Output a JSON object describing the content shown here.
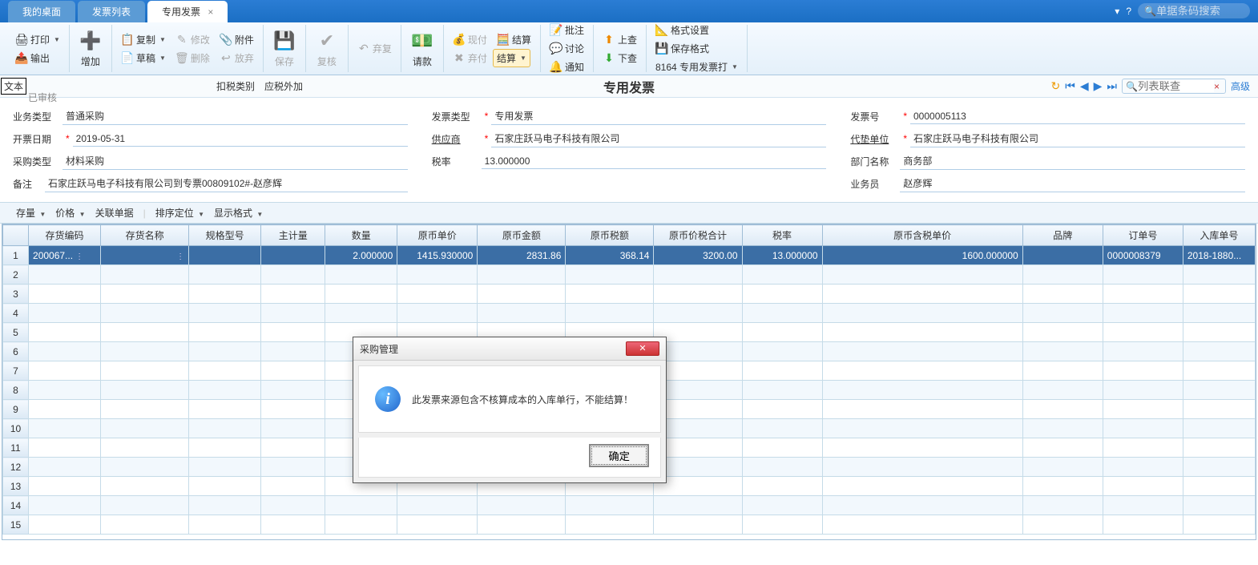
{
  "tabs": {
    "desktop": "我的桌面",
    "list": "发票列表",
    "current": "专用发票"
  },
  "topSearch": {
    "placeholder": "单据条码搜索"
  },
  "ribbon": {
    "print": "打印",
    "output": "输出",
    "add": "增加",
    "copy": "复制",
    "draft": "草稿",
    "modify": "修改",
    "delete": "删除",
    "attach": "附件",
    "abandon": "放弃",
    "save": "保存",
    "recheck": "复核",
    "recover": "弃复",
    "payreq": "请款",
    "cash": "现付",
    "abandonpay": "弃付",
    "settle": "结算",
    "settlebtn": "结算",
    "annotate": "批注",
    "discuss": "讨论",
    "notify": "通知",
    "prev": "上查",
    "next": "下查",
    "format": "格式设置",
    "saveformat": "保存格式",
    "printtpl": "8164 专用发票打"
  },
  "overlayText": "文本",
  "approveStatus": "已审核",
  "titleBar": {
    "taxTypeLabel": "扣税类别",
    "taxTypeVal": "应税外加",
    "title": "专用发票",
    "listSearch": "列表联查",
    "advanced": "高级"
  },
  "form": {
    "bizTypeLabel": "业务类型",
    "bizTypeVal": "普通采购",
    "invTypeLabel": "发票类型",
    "invTypeVal": "专用发票",
    "invNoLabel": "发票号",
    "invNoVal": "0000005113",
    "invDateLabel": "开票日期",
    "invDateVal": "2019-05-31",
    "supplierLabel": "供应商",
    "supplierVal": "石家庄跃马电子科技有限公司",
    "advUnitLabel": "代垫单位",
    "advUnitVal": "石家庄跃马电子科技有限公司",
    "purTypeLabel": "采购类型",
    "purTypeVal": "材料采购",
    "taxRateLabel": "税率",
    "taxRateVal": "13.000000",
    "deptLabel": "部门名称",
    "deptVal": "商务部",
    "remarkLabel": "备注",
    "remarkVal": "石家庄跃马电子科技有限公司到专票00809102#-赵彦辉",
    "salesmanLabel": "业务员",
    "salesmanVal": "赵彦辉"
  },
  "filters": {
    "stock": "存量",
    "price": "价格",
    "related": "关联单据",
    "sort": "排序定位",
    "display": "显示格式"
  },
  "columns": {
    "code": "存货编码",
    "name": "存货名称",
    "spec": "规格型号",
    "unit": "主计量",
    "qty": "数量",
    "price": "原币单价",
    "amount": "原币金额",
    "tax": "原币税额",
    "total": "原币价税合计",
    "rate": "税率",
    "taxprice": "原币含税单价",
    "brand": "品牌",
    "orderno": "订单号",
    "stockno": "入库单号"
  },
  "row": {
    "code": "200067...",
    "qty": "2.000000",
    "price": "1415.930000",
    "amount": "2831.86",
    "tax": "368.14",
    "total": "3200.00",
    "rate": "13.000000",
    "taxprice": "1600.000000",
    "orderno": "0000008379",
    "stockno": "2018-1880..."
  },
  "dialog": {
    "title": "采购管理",
    "message": "此发票来源包含不核算成本的入库单行，不能结算！",
    "ok": "确定"
  }
}
